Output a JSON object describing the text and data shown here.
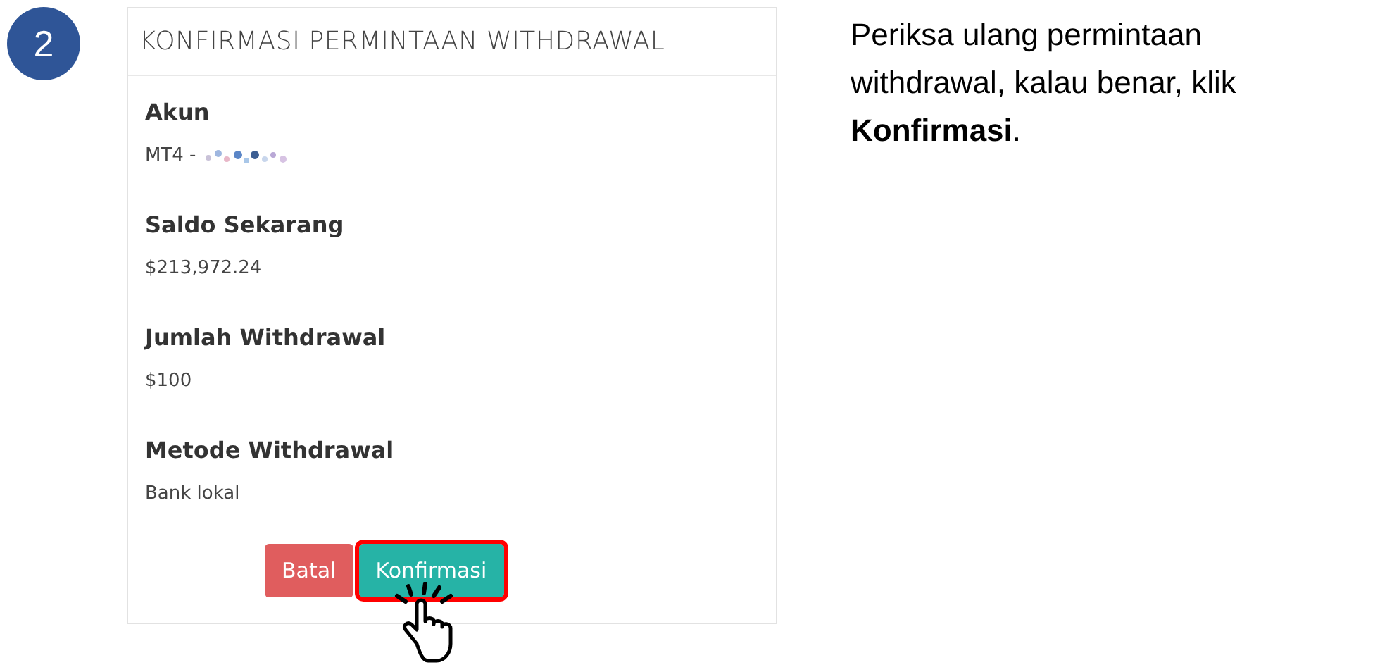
{
  "step": {
    "number": "2"
  },
  "dialog": {
    "title": "KONFIRMASI PERMINTAAN WITHDRAWAL",
    "fields": [
      {
        "label": "Akun",
        "value": "MT4 -",
        "redacted": true
      },
      {
        "label": "Saldo Sekarang",
        "value": "$213,972.24",
        "redacted": false
      },
      {
        "label": "Jumlah Withdrawal",
        "value": "$100",
        "redacted": false
      },
      {
        "label": "Metode Withdrawal",
        "value": "Bank lokal",
        "redacted": false
      }
    ],
    "buttons": [
      {
        "label": "Batal",
        "kind": "cancel",
        "highlighted": false
      },
      {
        "label": "Konfirmasi",
        "kind": "confirm",
        "highlighted": true
      }
    ]
  },
  "instruction": "Periksa ulang permintaan withdrawal, kalau benar, klik **Konfirmasi**."
}
